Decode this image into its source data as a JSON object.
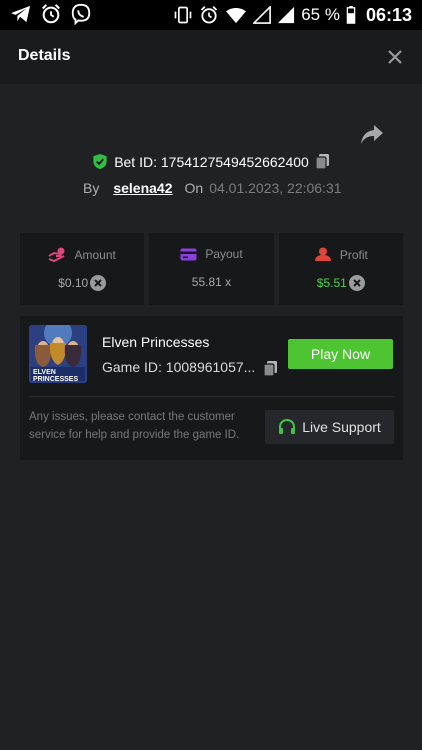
{
  "status_bar": {
    "battery_percent": "65 %",
    "time": "06:13",
    "left_icons": [
      "telegram-icon",
      "alarm-icon",
      "viber-icon"
    ],
    "right_icons": [
      "vibrate-icon",
      "alarm-icon",
      "wifi-icon",
      "signal-icon",
      "signal-icon",
      "battery-icon"
    ]
  },
  "header": {
    "title": "Details"
  },
  "bet": {
    "id_text": "Bet ID: 1754127549452662400",
    "by_label": "By",
    "username": "selena42",
    "on_label": "On",
    "date": "04.01.2023, 22:06:31"
  },
  "stats": [
    {
      "label": "Amount",
      "value": "$0.10",
      "icon": "amount-icon",
      "color": "#e0457b"
    },
    {
      "label": "Payout",
      "value": "55.81 x",
      "icon": "card-icon",
      "color": "#8b3fe0"
    },
    {
      "label": "Profit",
      "value": "$5.51",
      "icon": "profit-icon",
      "color": "#e0453a"
    }
  ],
  "game": {
    "name": "Elven Princesses",
    "game_id": "Game ID: 1008961057...",
    "thumb_text_1": "ELVEN",
    "thumb_text_2": "PRINCESSES",
    "play_label": "Play Now",
    "support_text": "Any issues, please contact the customer service for help and provide the game ID.",
    "support_label": "Live Support"
  },
  "colors": {
    "accent_green": "#4fc432",
    "background": "#202123",
    "card": "#17181a"
  }
}
